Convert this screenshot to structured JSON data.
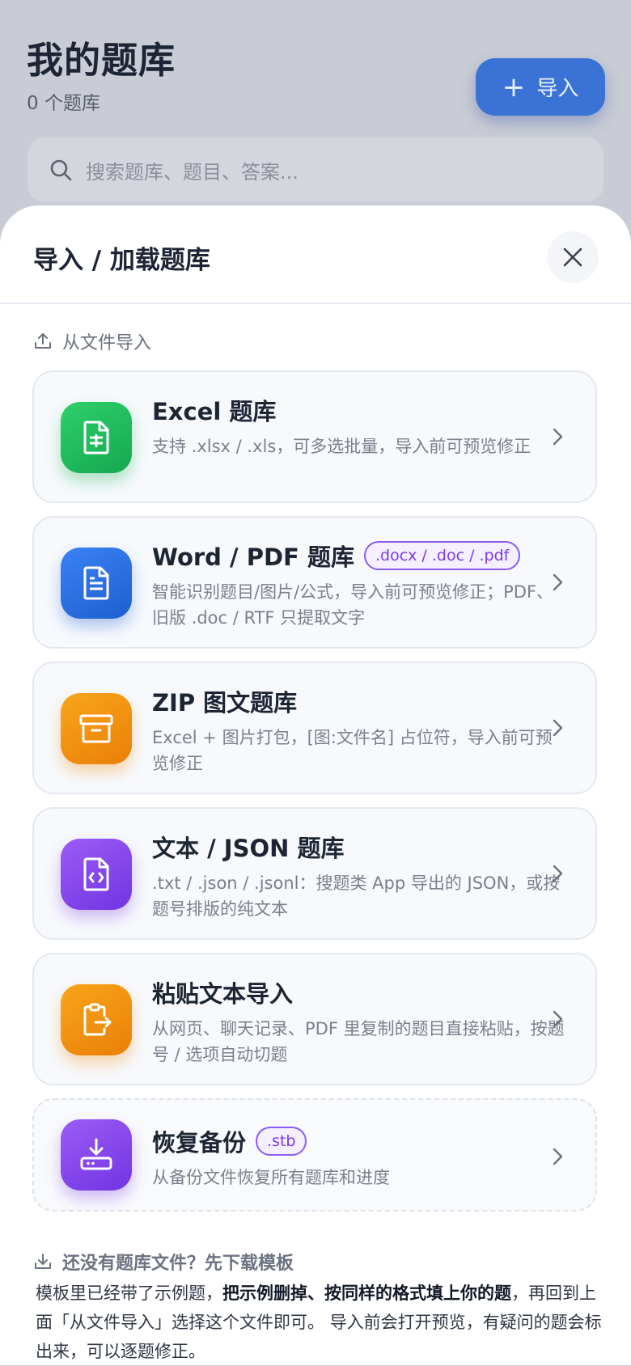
{
  "background": {
    "title": "我的题库",
    "count": "0 个题库",
    "import_label": "导入",
    "search_placeholder": "搜索题库、题目、答案..."
  },
  "sheet": {
    "title": "导入 / 加载题库",
    "section_label": "从文件导入",
    "cards": [
      {
        "title": "Excel 题库",
        "desc": "支持 .xlsx / .xls，可多选批量，导入前可预览修正",
        "icon": "excel-file-icon",
        "color": "#22c55e"
      },
      {
        "title": "Word / PDF 题库",
        "tag": ".docx / .doc / .pdf",
        "desc": "智能识别题目/图片/公式，导入前可预览修正；PDF、旧版 .doc / RTF 只提取文字",
        "icon": "document-icon",
        "color": "#2563eb"
      },
      {
        "title": "ZIP 图文题库",
        "desc": "Excel + 图片打包，[图:文件名] 占位符，导入前可预览修正",
        "icon": "archive-icon",
        "color": "#f59e0b"
      },
      {
        "title": "文本 / JSON 题库",
        "desc": ".txt / .json / .jsonl：搜题类 App 导出的 JSON，或按题号排版的纯文本",
        "icon": "code-file-icon",
        "color": "#8b5cf6"
      },
      {
        "title": "粘贴文本导入",
        "desc": "从网页、聊天记录、PDF 里复制的题目直接粘贴，按题号 / 选项自动切题",
        "icon": "clipboard-paste-icon",
        "color": "#f59e0b"
      },
      {
        "title": "恢复备份",
        "tag": ".stb",
        "desc": "从备份文件恢复所有题库和进度",
        "icon": "download-restore-icon",
        "color": "#8b5cf6"
      }
    ],
    "template_label": "还没有题库文件？先下载模板",
    "template_text_1": "模板里已经带了示例题，",
    "template_text_bold": "把示例删掉、按同样的格式填上你的题",
    "template_text_2": "，再回到上面「从文件导入」选择这个文件即可。 导入前会打开预览，有疑问的题会标出来，可以逐题修正。"
  }
}
